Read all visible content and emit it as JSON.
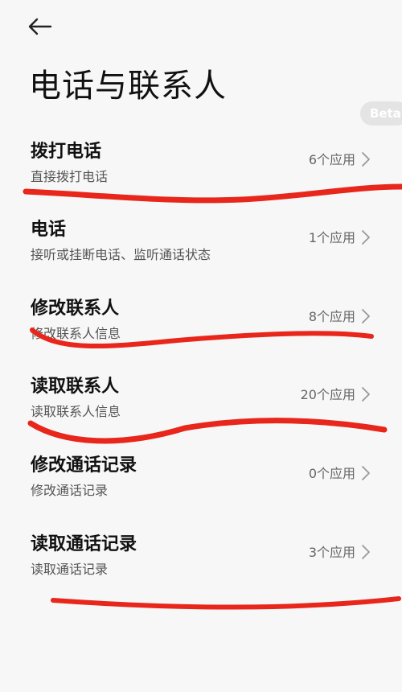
{
  "header": {
    "title": "电话与联系人",
    "beta_label": "Beta"
  },
  "items": [
    {
      "name": "拨打电话",
      "desc": "直接拨打电话",
      "count": "6个应用"
    },
    {
      "name": "电话",
      "desc": "接听或挂断电话、监听通话状态",
      "count": "1个应用"
    },
    {
      "name": "修改联系人",
      "desc": "修改联系人信息",
      "count": "8个应用"
    },
    {
      "name": "读取联系人",
      "desc": "读取联系人信息",
      "count": "20个应用"
    },
    {
      "name": "修改通话记录",
      "desc": "修改通话记录",
      "count": "0个应用"
    },
    {
      "name": "读取通话记录",
      "desc": "读取通话记录",
      "count": "3个应用"
    }
  ],
  "icons": {
    "back": "back-arrow-icon",
    "chevron": "chevron-right-icon"
  },
  "colors": {
    "background": "#f7f7f7",
    "annotation": "#e8261b"
  }
}
